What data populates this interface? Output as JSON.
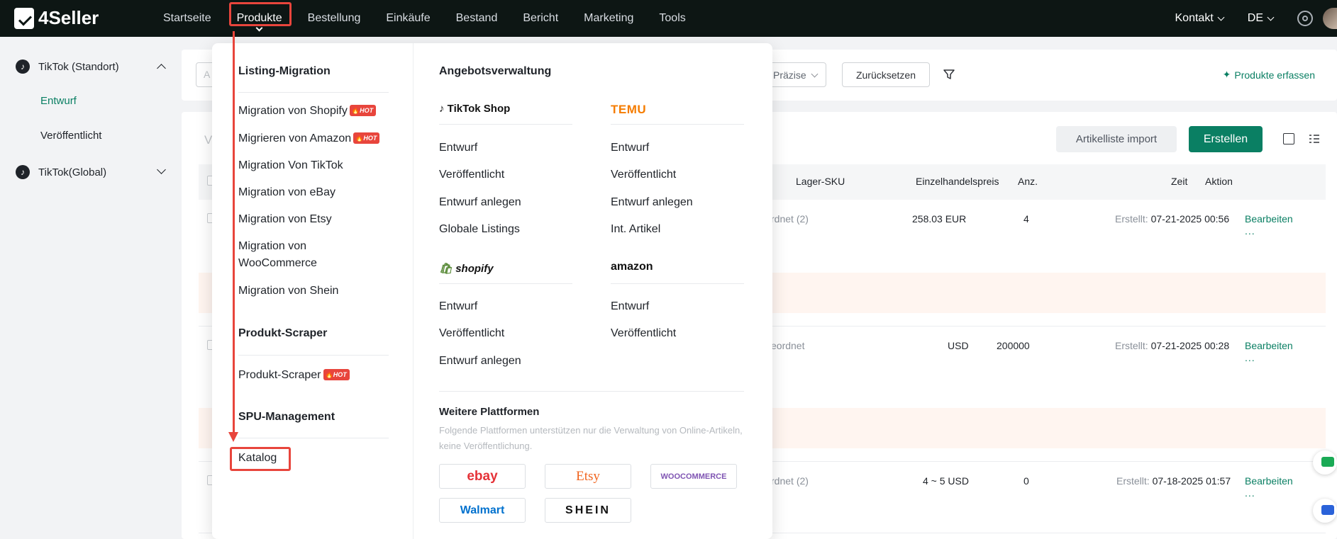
{
  "app": {
    "logo_text": "4Seller",
    "nav": [
      "Startseite",
      "Produkte",
      "Bestellung",
      "Einkäufe",
      "Bestand",
      "Bericht",
      "Marketing",
      "Tools"
    ],
    "contact": "Kontakt",
    "language": "DE"
  },
  "sidebar": {
    "group1": "TikTok (Standort)",
    "group1_items": [
      "Entwurf",
      "Veröffentlicht"
    ],
    "group2": "TikTok(Global)"
  },
  "filterbar": {
    "input_stub": "A",
    "select_value": "Präzise",
    "reset": "Zurücksetzen",
    "capture": "Produkte erfassen"
  },
  "panel": {
    "letter": "V",
    "import_button": "Artikelliste import",
    "create_button": "Erstellen",
    "columns": {
      "sku": "Lager-SKU",
      "price": "Einzelhandelspreis",
      "qty": "Anz.",
      "time": "Zeit",
      "action": "Aktion"
    },
    "rows": [
      {
        "sku": "rdnet",
        "sku_count": "(2)",
        "price": "258.03 EUR",
        "qty": "4",
        "time_label": "Erstellt:",
        "time": "07-21-2025 00:56",
        "action": "Bearbeiten",
        "more": "..."
      },
      {
        "sku": "eordnet",
        "sku_count": "",
        "price": "USD",
        "qty": "200000",
        "time_label": "Erstellt:",
        "time": "07-21-2025 00:28",
        "action": "Bearbeiten",
        "more": "..."
      },
      {
        "sku": "rdnet",
        "sku_count": "(2)",
        "price": "4 ~ 5 USD",
        "qty": "0",
        "time_label": "Erstellt:",
        "time": "07-18-2025 01:57",
        "action": "Bearbeiten",
        "more": "..."
      }
    ]
  },
  "menu": {
    "listing_migration": {
      "title": "Listing-Migration",
      "items": [
        "Migration von Shopify",
        "Migrieren von Amazon",
        "Migration Von TikTok",
        "Migration von eBay",
        "Migration von Etsy",
        "Migration von WooCommerce",
        "Migration von Shein"
      ]
    },
    "hot_label": "HOT",
    "scraper": {
      "title": "Produkt-Scraper",
      "items": [
        "Produkt-Scraper"
      ]
    },
    "spu": {
      "title": "SPU-Management",
      "items": [
        "Katalog"
      ]
    },
    "offer_management": {
      "title": "Angebotsverwaltung",
      "tiktok_brand": "TikTok Shop",
      "tiktok_items": [
        "Entwurf",
        "Veröffentlicht",
        "Entwurf anlegen",
        "Globale Listings"
      ],
      "temu_brand": "TEMU",
      "temu_items": [
        "Entwurf",
        "Veröffentlicht",
        "Entwurf anlegen",
        "Int. Artikel"
      ],
      "shopify_brand": "shopify",
      "shopify_items": [
        "Entwurf",
        "Veröffentlicht",
        "Entwurf anlegen"
      ],
      "amazon_brand": "amazon",
      "amazon_items": [
        "Entwurf",
        "Veröffentlicht"
      ]
    },
    "more_platforms": {
      "title": "Weitere Plattformen",
      "note": "Folgende Plattformen unterstützen nur die Verwaltung von Online-Artikeln, keine Veröffentlichung.",
      "platforms": [
        "ebay",
        "Etsy",
        "WOOCOMMERCE",
        "Walmart",
        "SHEIN"
      ]
    }
  },
  "colors": {
    "accent": "#0a7f63",
    "highlight": "#e8453c",
    "topbar": "#0d1614"
  }
}
